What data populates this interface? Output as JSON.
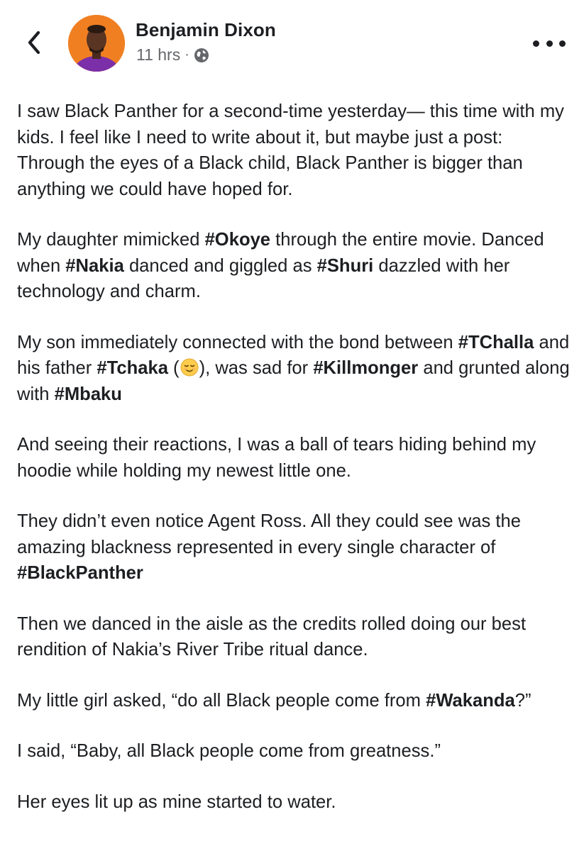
{
  "header": {
    "back_icon": "chevron-left-icon",
    "author": "Benjamin Dixon",
    "time": "11 hrs",
    "separator": "·",
    "privacy_icon": "globe-icon",
    "more_icon": "more-horizontal-icon"
  },
  "post": {
    "p1": "I saw Black Panther for a second-time yesterday— this time with my kids. I feel like I need to write about it, but maybe just a post: Through the eyes of a Black child, Black Panther is bigger than anything we could have hoped for.",
    "p2": {
      "t1": "My daughter mimicked ",
      "tag1": "#Okoye",
      "t2": " through the entire movie. Danced when ",
      "tag2": "#Nakia",
      "t3": " danced and giggled as ",
      "tag3": "#Shuri",
      "t4": " dazzled with her technology and charm."
    },
    "p3": {
      "t1": "My son immediately connected with the bond between ",
      "tag1": "#TChalla",
      "t2": " and his father ",
      "tag2": "#Tchaka",
      "t3": " (",
      "emoji": "relieved-face-emoji",
      "t4": "), was sad for ",
      "tag3": "#Killmonger",
      "t5": " and grunted along with ",
      "tag4": "#Mbaku"
    },
    "p4": "And seeing their reactions, I was a ball of tears hiding behind my hoodie while holding my newest little one.",
    "p5": {
      "t1": "They didn’t even notice Agent Ross. All they could see was the amazing blackness represented in every single character of ",
      "tag1": "#BlackPanther"
    },
    "p6": "Then we danced in the aisle as the credits rolled doing our best rendition of Nakia’s River Tribe ritual dance.",
    "p7": {
      "t1": "My little girl asked, “do all Black people come from ",
      "tag1": "#Wakanda",
      "t2": "?”"
    },
    "p8": "I said, “Baby, all Black people come from greatness.”",
    "p9": "Her eyes lit up as mine started to water."
  },
  "colors": {
    "text": "#1c1e21",
    "meta": "#65676b",
    "avatar_bg": "#f07f22",
    "shirt": "#7b2fa8"
  }
}
